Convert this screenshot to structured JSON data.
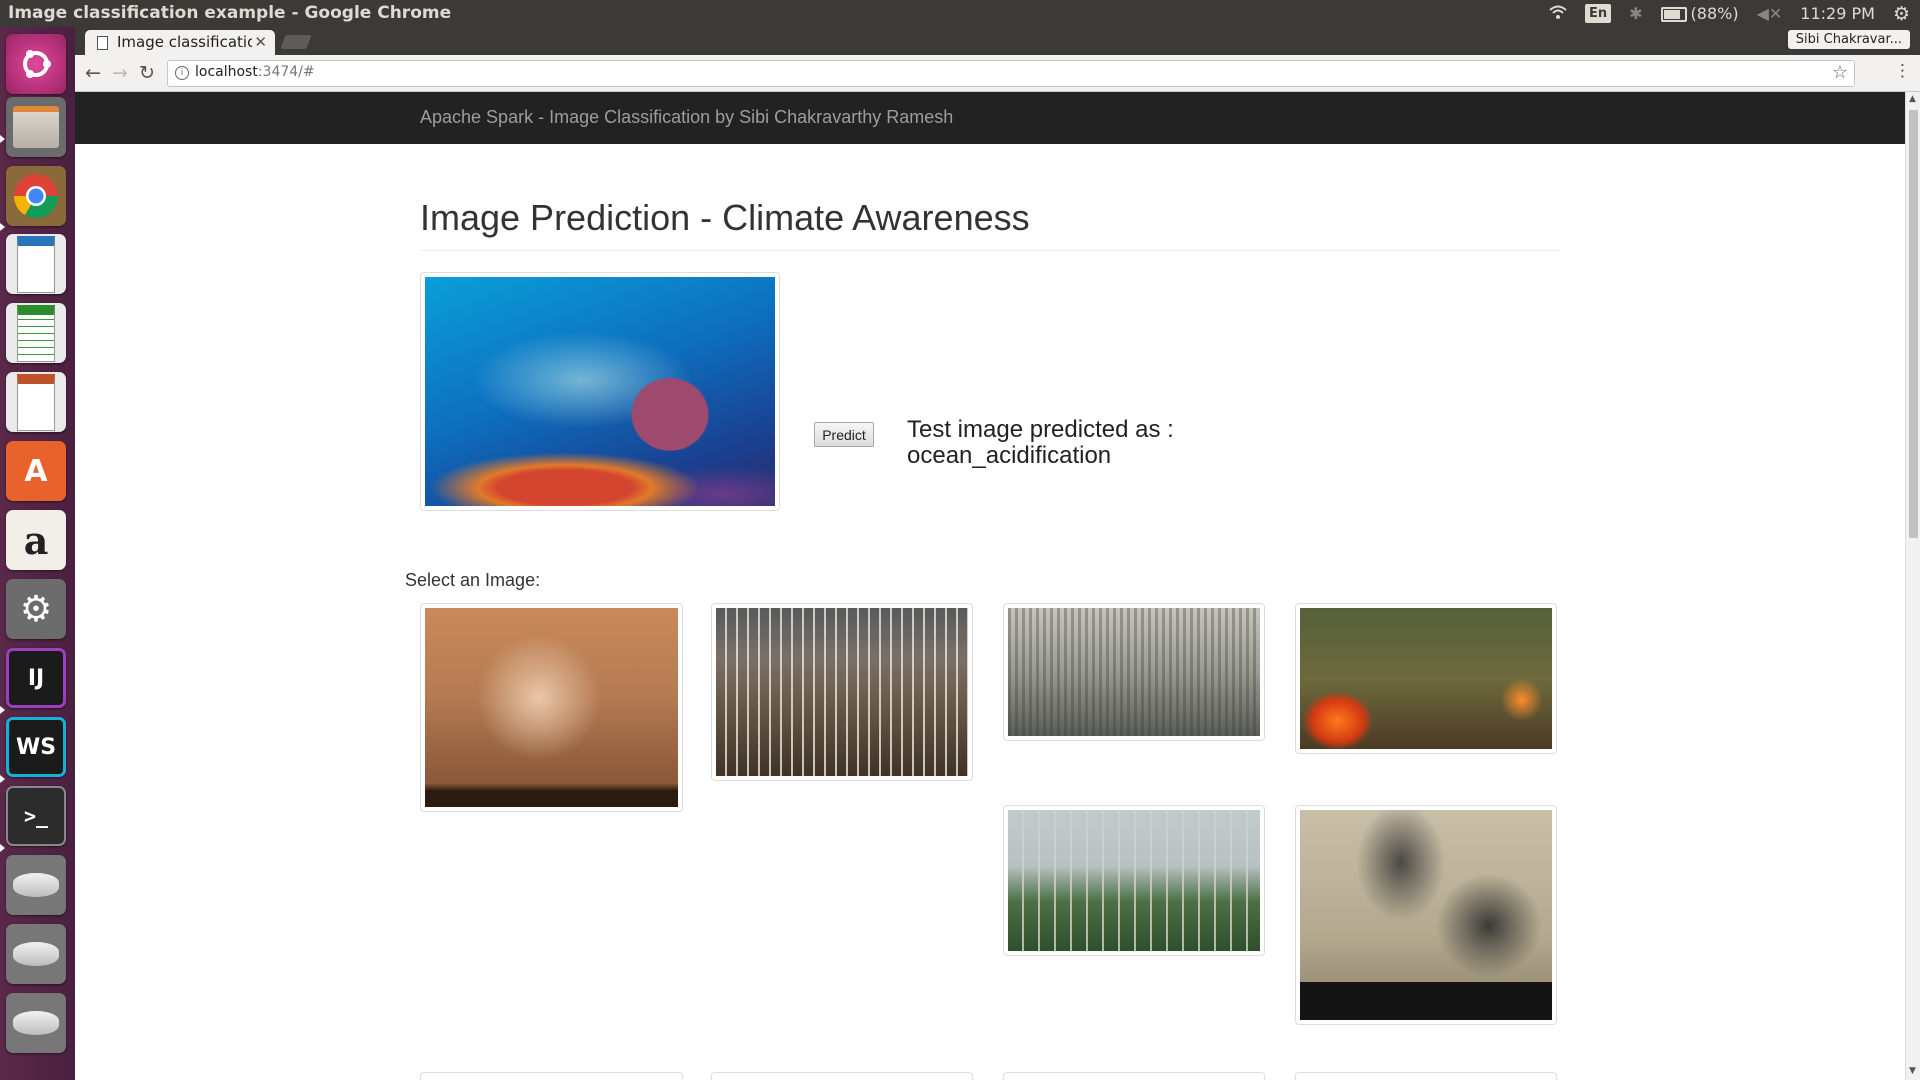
{
  "os": {
    "window_title": "Image classification example - Google Chrome",
    "keyboard_layout": "En",
    "battery": "(88%)",
    "time": "11:29 PM"
  },
  "launcher": {
    "items": [
      {
        "name": "dash-home",
        "label": ""
      },
      {
        "name": "files",
        "label": ""
      },
      {
        "name": "chrome",
        "label": ""
      },
      {
        "name": "libreoffice-writer",
        "label": ""
      },
      {
        "name": "libreoffice-calc",
        "label": ""
      },
      {
        "name": "libreoffice-impress",
        "label": ""
      },
      {
        "name": "software-center",
        "label": "A"
      },
      {
        "name": "amazon",
        "label": "a"
      },
      {
        "name": "system-settings",
        "label": ""
      },
      {
        "name": "intellij",
        "label": "IJ"
      },
      {
        "name": "webstorm",
        "label": "WS"
      },
      {
        "name": "terminal",
        "label": ">_"
      },
      {
        "name": "drive-1",
        "label": ""
      },
      {
        "name": "drive-2",
        "label": ""
      },
      {
        "name": "drive-3",
        "label": ""
      }
    ]
  },
  "browser": {
    "tab_title": "Image classificatio",
    "profile_name": "Sibi Chakravar...",
    "url_host": "localhost",
    "url_rest": ":3474/#"
  },
  "page": {
    "brand": "Apache Spark - Image Classification by Sibi Chakravarthy Ramesh",
    "title": "Image Prediction - Climate Awareness",
    "predict_label": "Predict",
    "result_prefix": "Test image predicted as :",
    "result_value": "ocean_acidification",
    "select_label": "Select an Image:"
  },
  "colors": {
    "navbar": "#222222",
    "launcher": "#4a2040"
  }
}
